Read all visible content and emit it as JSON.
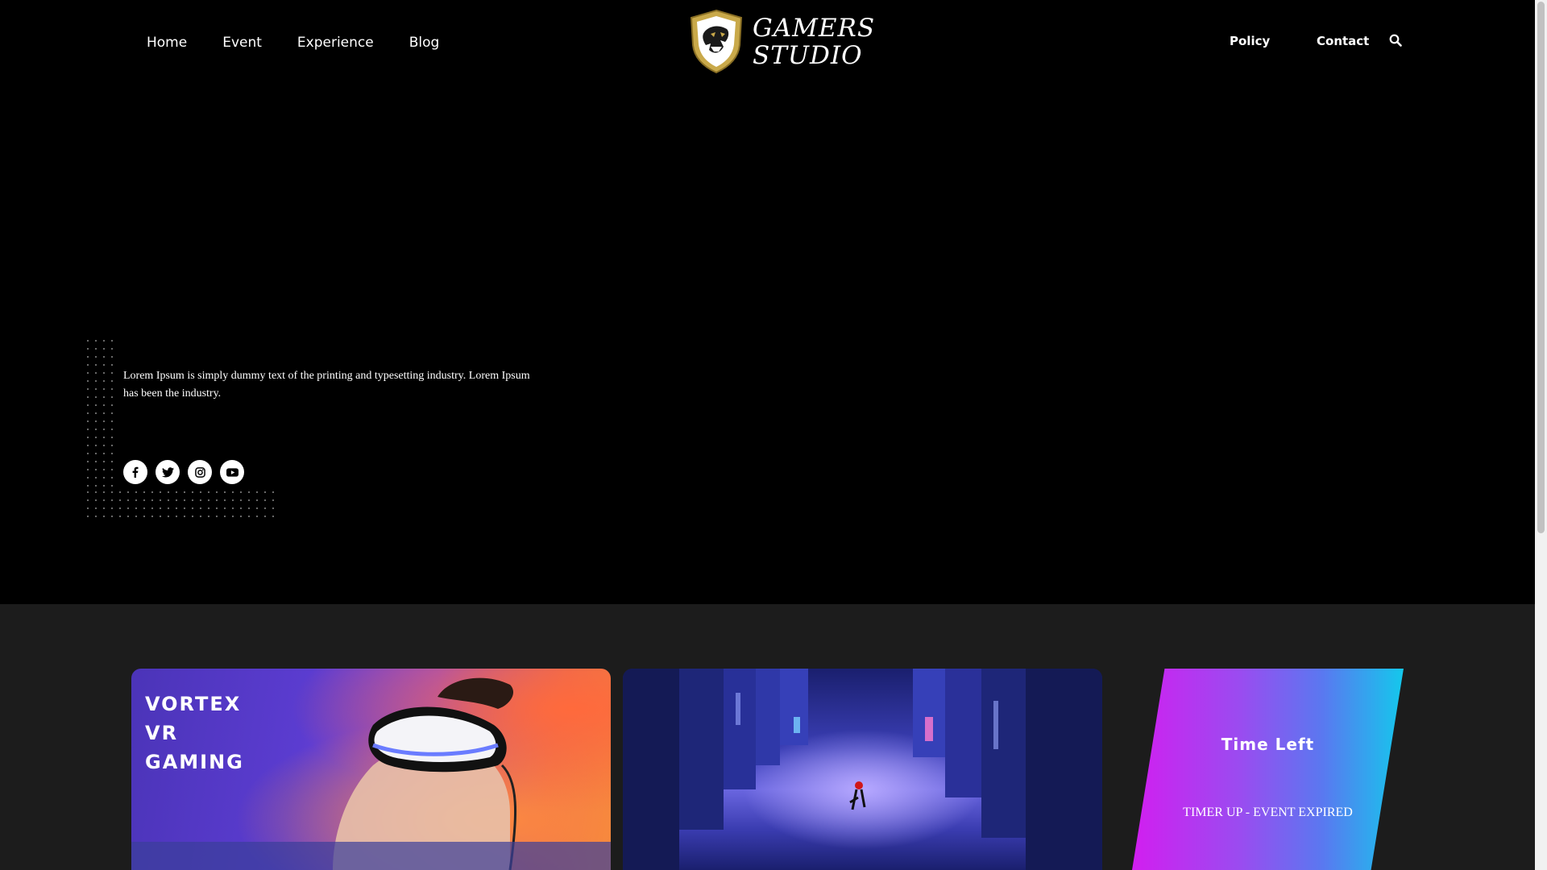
{
  "nav": {
    "left": [
      {
        "label": "Home"
      },
      {
        "label": "Event"
      },
      {
        "label": "Experience"
      },
      {
        "label": "Blog"
      }
    ],
    "policy": "Policy",
    "contact": "Contact"
  },
  "logo": {
    "line1": "GAMERS",
    "line2": "STUDIO"
  },
  "hero": {
    "description": "Lorem Ipsum is simply dummy text of the printing and typesetting industry. Lorem Ipsum has been the industry."
  },
  "socials": [
    "facebook-icon",
    "twitter-icon",
    "instagram-icon",
    "youtube-icon"
  ],
  "cards": {
    "vr": {
      "line1": "VORTEX",
      "line2": "VR",
      "line3": "GAMING"
    },
    "timer": {
      "title": "Time Left",
      "status": "TIMER UP - EVENT EXPIRED"
    }
  },
  "colors": {
    "background": "#000000",
    "lower_background": "#1c1c1c",
    "logo_gold": "#c9a94a",
    "timer_gradient_start": "#d21ef0",
    "timer_gradient_end": "#14c8ec"
  }
}
